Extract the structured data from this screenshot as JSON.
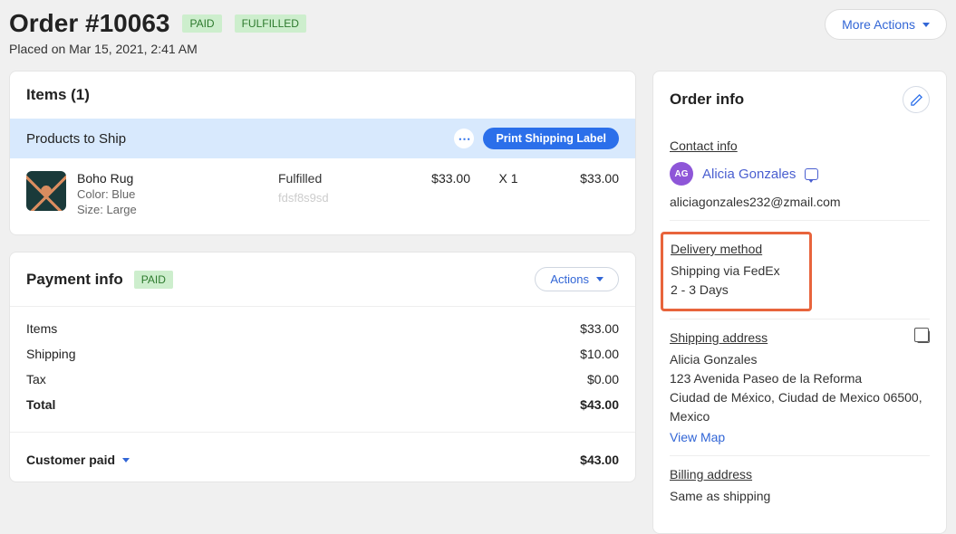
{
  "header": {
    "title": "Order #10063",
    "badge_paid": "PAID",
    "badge_fulfilled": "FULFILLED",
    "placed_on": "Placed on Mar 15, 2021, 2:41 AM",
    "more_actions": "More Actions"
  },
  "items_card": {
    "title": "Items (1)",
    "ship_bar_label": "Products to Ship",
    "print_label": "Print Shipping Label",
    "item": {
      "name": "Boho Rug",
      "color": "Color: Blue",
      "size": "Size: Large",
      "status": "Fulfilled",
      "sku": "fdsf8s9sd",
      "price": "$33.00",
      "qty": "X 1",
      "total": "$33.00"
    }
  },
  "payment": {
    "title": "Payment info",
    "badge": "PAID",
    "actions": "Actions",
    "rows": {
      "items_label": "Items",
      "items_val": "$33.00",
      "shipping_label": "Shipping",
      "shipping_val": "$10.00",
      "tax_label": "Tax",
      "tax_val": "$0.00",
      "total_label": "Total",
      "total_val": "$43.00"
    },
    "customer_paid_label": "Customer paid",
    "customer_paid_val": "$43.00"
  },
  "order_info": {
    "title": "Order info",
    "contact_label": "Contact info",
    "avatar_initials": "AG",
    "contact_name": "Alicia Gonzales",
    "email": "aliciagonzales232@zmail.com",
    "delivery_label": "Delivery method",
    "delivery_line1": "Shipping via FedEx",
    "delivery_line2": "2 - 3 Days",
    "shipping_label": "Shipping address",
    "ship_name": "Alicia Gonzales",
    "ship_addr1": "123 Avenida Paseo de la Reforma",
    "ship_addr2": "Ciudad de México, Ciudad de Mexico 06500, Mexico",
    "view_map": "View Map",
    "billing_label": "Billing address",
    "billing_text": "Same as shipping"
  }
}
